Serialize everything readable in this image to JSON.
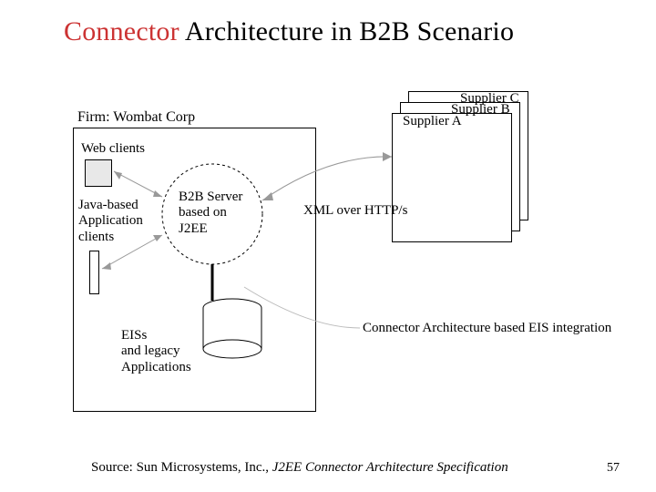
{
  "title": {
    "part1": "Connector",
    "part2": " Architecture in B2B Scenario"
  },
  "diagram": {
    "firm_label": "Firm: Wombat Corp",
    "web_clients": "Web clients",
    "java_clients": "Java-based\nApplication\nclients",
    "b2b_server": "B2B Server\nbased on\nJ2EE",
    "eis_legacy": "EISs\nand legacy\nApplications",
    "supplier_a": "Supplier A",
    "supplier_b": "Supplier B",
    "supplier_c": "Supplier C",
    "xml_http": "XML over HTTP/s",
    "connector_note": "Connector Architecture based EIS integration"
  },
  "footer": {
    "src1": "Source: Sun Microsystems, Inc., ",
    "src2": "J2EE Connector Architecture Specification"
  },
  "page_number": "57"
}
